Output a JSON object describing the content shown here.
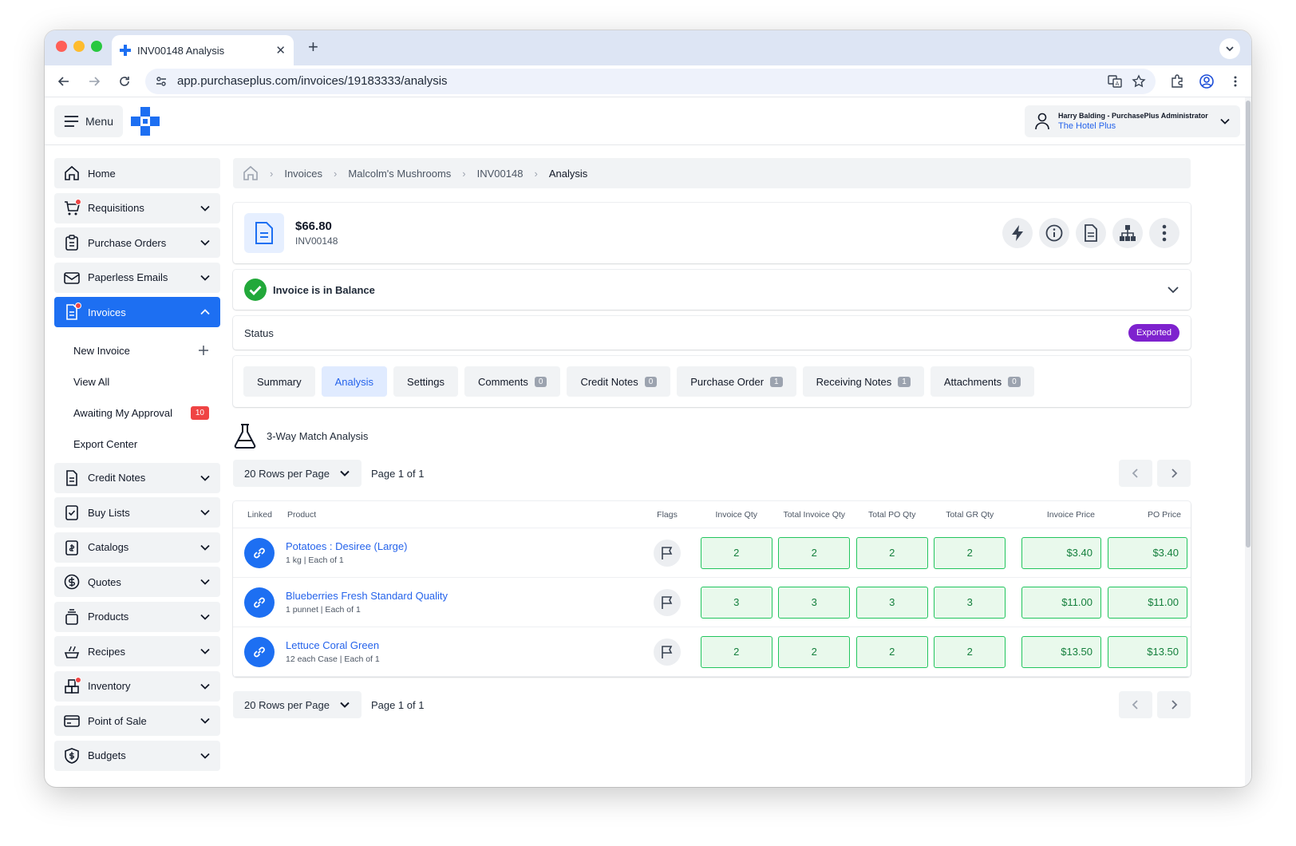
{
  "browser": {
    "tab_title": "INV00148 Analysis",
    "url_host": "app.purchaseplus.com",
    "url_path": "/invoices/19183333/analysis"
  },
  "header": {
    "menu_label": "Menu",
    "user_name": "Harry Balding - PurchasePlus Administrator",
    "user_org": "The Hotel Plus"
  },
  "sidebar": {
    "items": [
      {
        "label": "Home",
        "icon": "home-icon"
      },
      {
        "label": "Requisitions",
        "icon": "cart-icon"
      },
      {
        "label": "Purchase Orders",
        "icon": "clipboard-icon"
      },
      {
        "label": "Paperless Emails",
        "icon": "mail-icon"
      },
      {
        "label": "Invoices",
        "icon": "document-icon"
      },
      {
        "label": "Credit Notes",
        "icon": "document-icon"
      },
      {
        "label": "Buy Lists",
        "icon": "checklist-icon"
      },
      {
        "label": "Catalogs",
        "icon": "catalog-icon"
      },
      {
        "label": "Quotes",
        "icon": "dollar-icon"
      },
      {
        "label": "Products",
        "icon": "box-icon"
      },
      {
        "label": "Recipes",
        "icon": "recipe-icon"
      },
      {
        "label": "Inventory",
        "icon": "inventory-icon"
      },
      {
        "label": "Point of Sale",
        "icon": "card-icon"
      },
      {
        "label": "Budgets",
        "icon": "shield-dollar-icon"
      }
    ],
    "invoices_sub": [
      {
        "label": "New Invoice"
      },
      {
        "label": "View All"
      },
      {
        "label": "Awaiting My Approval",
        "badge": "10"
      },
      {
        "label": "Export Center"
      }
    ]
  },
  "breadcrumb": [
    "Invoices",
    "Malcolm's Mushrooms",
    "INV00148",
    "Analysis"
  ],
  "invoice": {
    "amount": "$66.80",
    "number": "INV00148",
    "balance_text": "Invoice is in Balance",
    "status_label": "Status",
    "status_value": "Exported"
  },
  "tabs": [
    {
      "label": "Summary"
    },
    {
      "label": "Analysis"
    },
    {
      "label": "Settings"
    },
    {
      "label": "Comments",
      "count": "0"
    },
    {
      "label": "Credit Notes",
      "count": "0"
    },
    {
      "label": "Purchase Order",
      "count": "1"
    },
    {
      "label": "Receiving Notes",
      "count": "1"
    },
    {
      "label": "Attachments",
      "count": "0"
    }
  ],
  "section_title": "3-Way Match Analysis",
  "pager": {
    "rows_per_page": "20 Rows per Page",
    "page_text": "Page 1 of 1"
  },
  "table": {
    "headers": {
      "linked": "Linked",
      "product": "Product",
      "flags": "Flags",
      "invoice_qty": "Invoice Qty",
      "total_invoice_qty": "Total Invoice Qty",
      "total_po_qty": "Total PO Qty",
      "total_gr_qty": "Total GR Qty",
      "invoice_price": "Invoice Price",
      "po_price": "PO Price"
    },
    "rows": [
      {
        "name": "Potatoes : Desiree (Large)",
        "desc": "1 kg | Each of 1",
        "invoice_qty": "2",
        "total_invoice_qty": "2",
        "total_po_qty": "2",
        "total_gr_qty": "2",
        "invoice_price": "$3.40",
        "po_price": "$3.40"
      },
      {
        "name": "Blueberries Fresh Standard Quality",
        "desc": "1 punnet | Each of 1",
        "invoice_qty": "3",
        "total_invoice_qty": "3",
        "total_po_qty": "3",
        "total_gr_qty": "3",
        "invoice_price": "$11.00",
        "po_price": "$11.00"
      },
      {
        "name": "Lettuce Coral Green",
        "desc": "12 each Case | Each of 1",
        "invoice_qty": "2",
        "total_invoice_qty": "2",
        "total_po_qty": "2",
        "total_gr_qty": "2",
        "invoice_price": "$13.50",
        "po_price": "$13.50"
      }
    ]
  },
  "colors": {
    "brand": "#1d6ff2",
    "exported": "#7e22ce",
    "match_green": "#22c55e",
    "alert_red": "#ef4444"
  }
}
